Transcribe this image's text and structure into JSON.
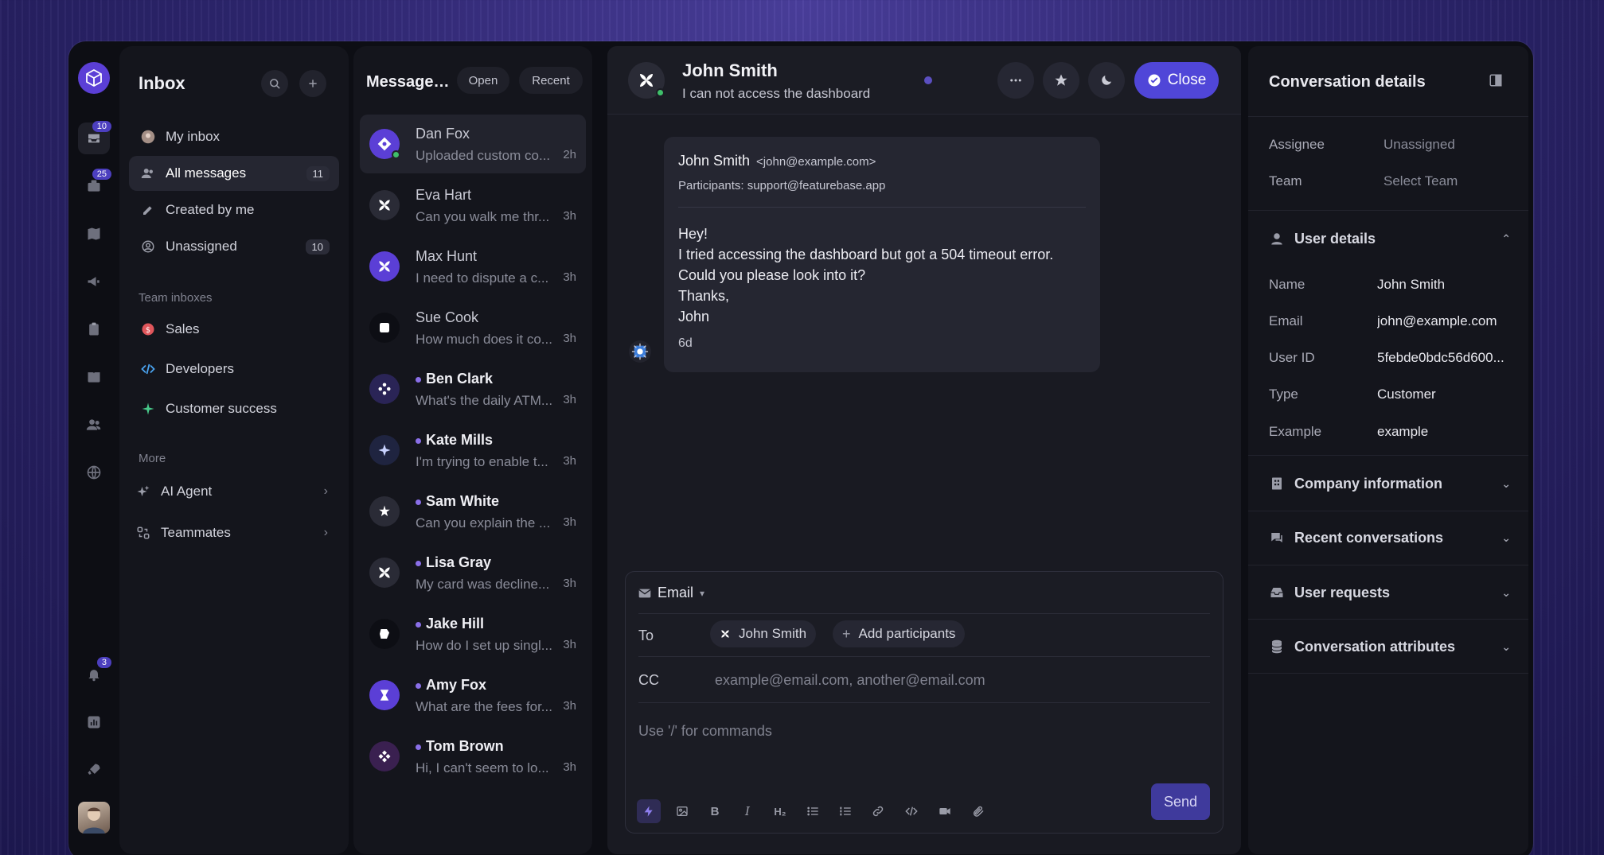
{
  "rail": {
    "badges": {
      "inbox": "10",
      "tickets": "25",
      "notifications": "3"
    }
  },
  "nav": {
    "title": "Inbox",
    "items": [
      {
        "label": "My inbox"
      },
      {
        "label": "All messages",
        "count": "11"
      },
      {
        "label": "Created by me"
      },
      {
        "label": "Unassigned",
        "count": "10"
      }
    ],
    "team_section": "Team inboxes",
    "teams": [
      {
        "label": "Sales"
      },
      {
        "label": "Developers"
      },
      {
        "label": "Customer success"
      }
    ],
    "more_section": "More",
    "more": [
      {
        "label": "AI Agent"
      },
      {
        "label": "Teammates"
      }
    ]
  },
  "list": {
    "title": "Messages...",
    "filter_open": "Open",
    "filter_recent": "Recent",
    "rows": [
      {
        "name": "Dan Fox",
        "preview": "Uploaded custom co...",
        "time": "2h"
      },
      {
        "name": "Eva Hart",
        "preview": "Can you walk me thr...",
        "time": "3h"
      },
      {
        "name": "Max Hunt",
        "preview": "I need to dispute a c...",
        "time": "3h"
      },
      {
        "name": "Sue Cook",
        "preview": "How much does it co...",
        "time": "3h"
      },
      {
        "name": "Ben Clark",
        "preview": "What's the daily ATM...",
        "time": "3h"
      },
      {
        "name": "Kate Mills",
        "preview": "I'm trying to enable t...",
        "time": "3h"
      },
      {
        "name": "Sam White",
        "preview": "Can you explain the ...",
        "time": "3h"
      },
      {
        "name": "Lisa Gray",
        "preview": "My card was decline...",
        "time": "3h"
      },
      {
        "name": "Jake Hill",
        "preview": "How do I set up singl...",
        "time": "3h"
      },
      {
        "name": "Amy Fox",
        "preview": "What are the fees for...",
        "time": "3h"
      },
      {
        "name": "Tom Brown",
        "preview": "Hi, I can't seem to lo...",
        "time": "3h"
      }
    ]
  },
  "conversation": {
    "name": "John Smith",
    "subject": "I can not access the dashboard",
    "close_label": "Close",
    "message": {
      "from_name": "John Smith",
      "from_email": "<john@example.com>",
      "participants": "Participants: support@featurebase.app",
      "lines": [
        "Hey!",
        "I tried accessing the dashboard but got a 504 timeout error.",
        "Could you please look into it?",
        "Thanks,",
        "John"
      ],
      "time": "6d"
    },
    "composer": {
      "channel": "Email",
      "to_label": "To",
      "to_chip": "John Smith",
      "add_participants": "Add participants",
      "cc_label": "CC",
      "cc_placeholder": "example@email.com, another@email.com",
      "body_placeholder": "Use '/' for commands",
      "send_label": "Send"
    }
  },
  "details": {
    "title": "Conversation details",
    "assignee_label": "Assignee",
    "assignee_value": "Unassigned",
    "team_label": "Team",
    "team_value": "Select Team",
    "user_section": "User details",
    "user": [
      {
        "key": "Name",
        "value": "John Smith"
      },
      {
        "key": "Email",
        "value": "john@example.com"
      },
      {
        "key": "User ID",
        "value": "5febde0bdc56d600..."
      },
      {
        "key": "Type",
        "value": "Customer"
      },
      {
        "key": "Example",
        "value": "example"
      }
    ],
    "sections": [
      "Company information",
      "Recent conversations",
      "User requests",
      "Conversation attributes"
    ]
  }
}
